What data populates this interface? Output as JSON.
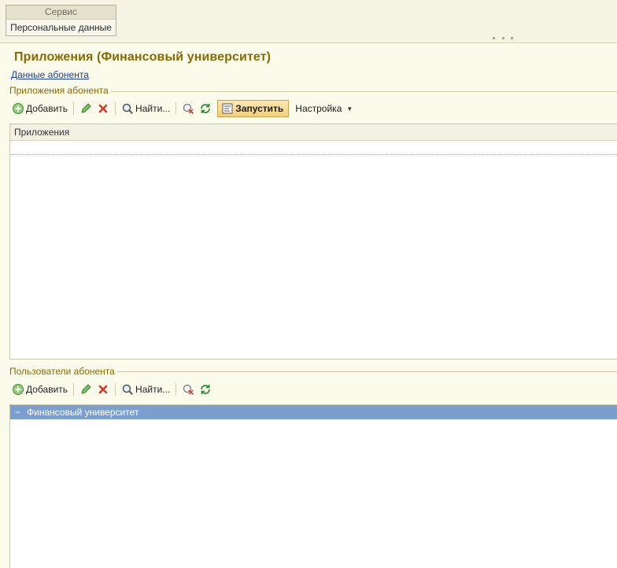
{
  "top_menu": {
    "section": "Сервис",
    "item": "Персональные данные"
  },
  "page": {
    "title": "Приложения (Финансовый университет)",
    "subscriber_link": "Данные абонента"
  },
  "apps_group": {
    "label": "Приложения абонента",
    "toolbar": {
      "add": "Добавить",
      "find": "Найти...",
      "run": "Запустить",
      "settings": "Настройка"
    },
    "table": {
      "column": "Приложения",
      "rows": []
    }
  },
  "users_group": {
    "label": "Пользователи абонента",
    "toolbar": {
      "add": "Добавить",
      "find": "Найти..."
    },
    "tree": {
      "rows": [
        {
          "label": "Финансовый университет",
          "expanded": true,
          "selected": true
        }
      ]
    }
  },
  "colors": {
    "background": "#fbfbec",
    "title": "#8a6a00",
    "selected_row": "#7a9fcf",
    "link": "#1c3d99"
  }
}
